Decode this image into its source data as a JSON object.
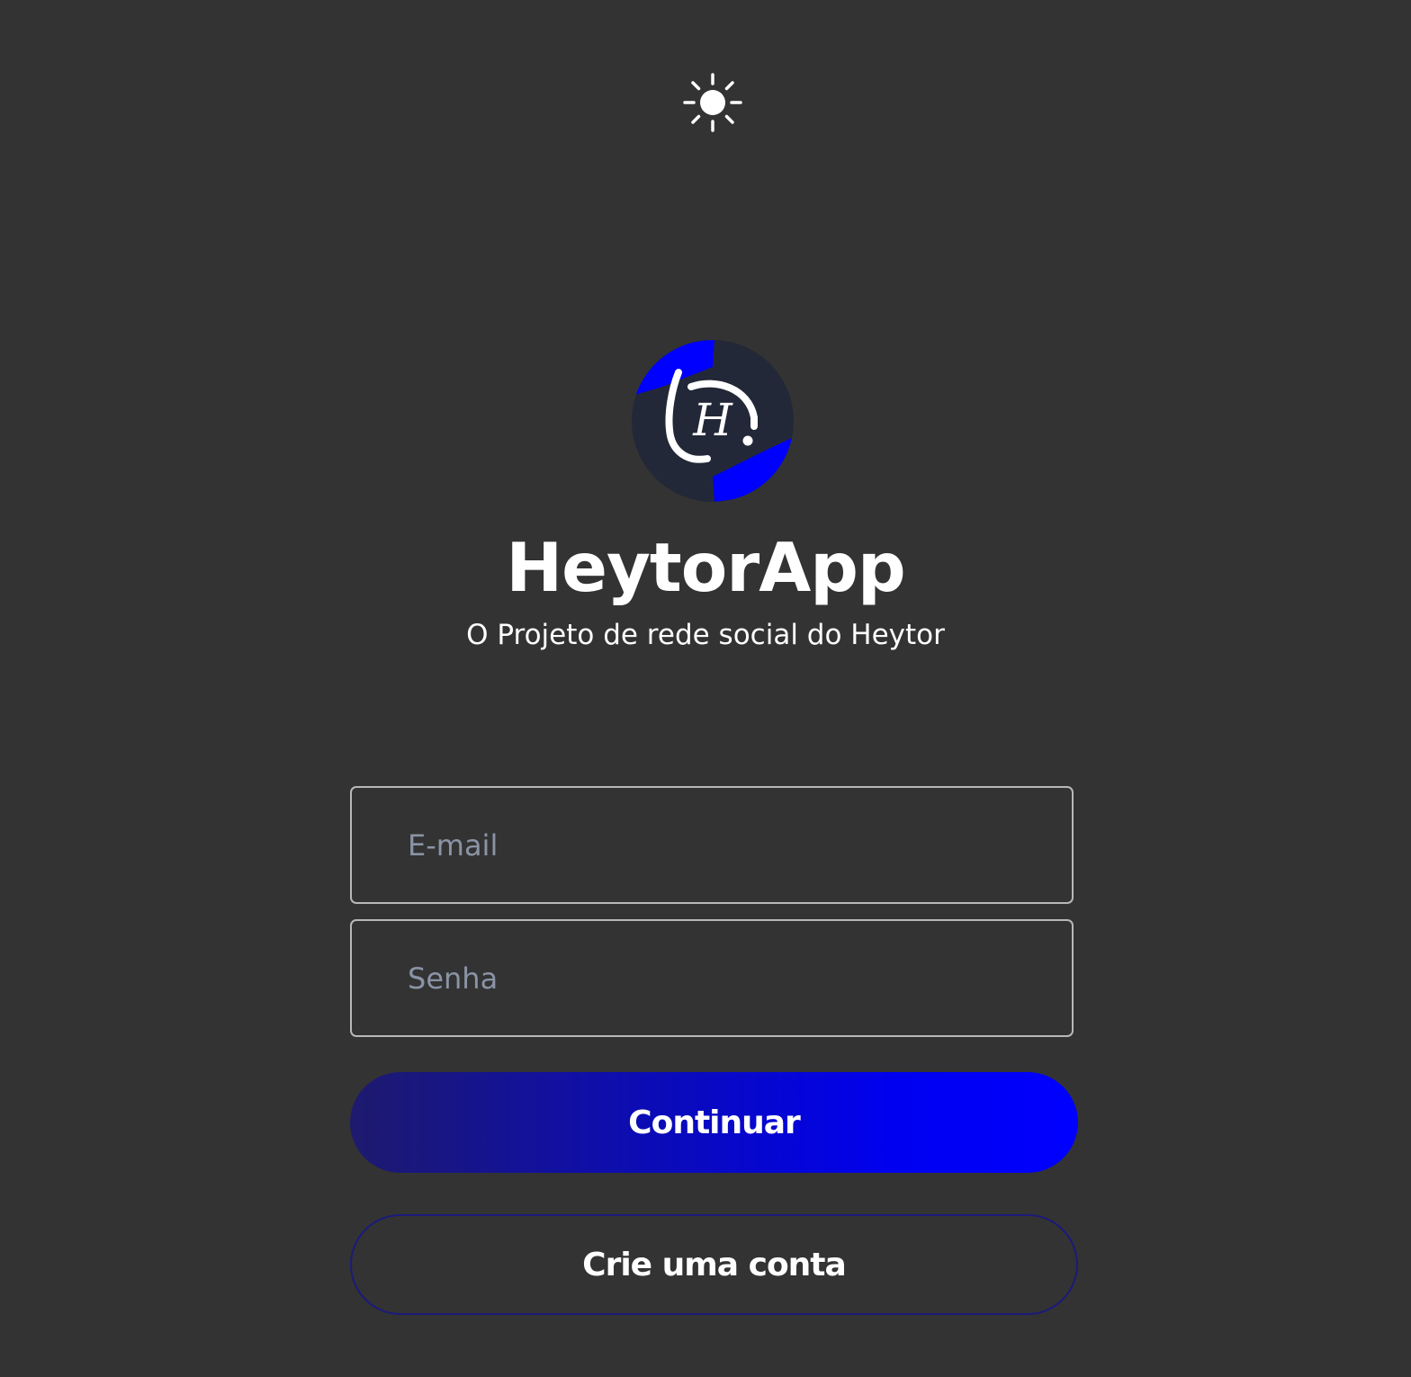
{
  "theme_toggle": {
    "icon": "sun-icon"
  },
  "brand": {
    "logo_icon": "heytor-logo",
    "logo_letter": "H",
    "title": "HeytorApp",
    "subtitle": "O Projeto de rede social do Heytor"
  },
  "login_form": {
    "email_placeholder": "E-mail",
    "password_placeholder": "Senha",
    "continue_label": "Continuar",
    "create_account_label": "Crie uma conta"
  },
  "colors": {
    "background": "#333333",
    "accent": "#0000ff",
    "accent_dark": "#1e1a6e",
    "logo_background": "#232838",
    "text": "#ffffff",
    "placeholder": "#8a94a6",
    "field_border": "#b8b8b8"
  }
}
